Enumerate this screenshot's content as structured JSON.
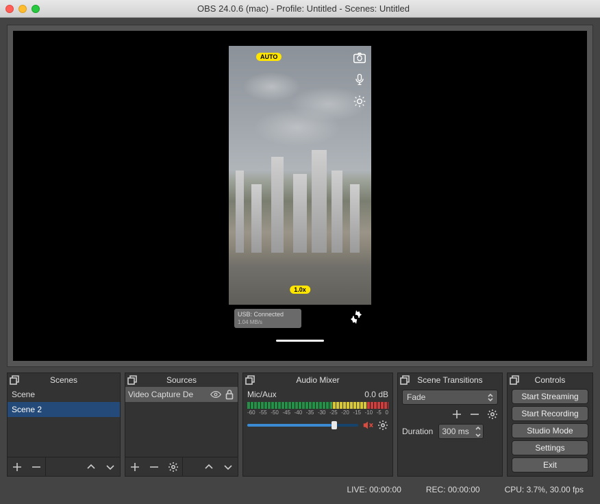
{
  "window": {
    "title": "OBS 24.0.6 (mac) - Profile: Untitled - Scenes: Untitled"
  },
  "preview": {
    "auto_badge": "AUTO",
    "zoom_badge": "1.0x",
    "usb_title": "USB: Connected",
    "usb_sub": "1.04 MB/s"
  },
  "docks": {
    "scenes": {
      "title": "Scenes",
      "items": [
        "Scene",
        "Scene 2"
      ],
      "selected": 1
    },
    "sources": {
      "title": "Sources",
      "items": [
        {
          "label": "Video Capture De"
        }
      ]
    },
    "mixer": {
      "title": "Audio Mixer",
      "channel": "Mic/Aux",
      "level": "0.0 dB",
      "ticks": [
        "-60",
        "-55",
        "-50",
        "-45",
        "-40",
        "-35",
        "-30",
        "-25",
        "-20",
        "-15",
        "-10",
        "-5",
        "0"
      ]
    },
    "transitions": {
      "title": "Scene Transitions",
      "selected": "Fade",
      "duration_label": "Duration",
      "duration_value": "300 ms"
    },
    "controls": {
      "title": "Controls",
      "buttons": [
        "Start Streaming",
        "Start Recording",
        "Studio Mode",
        "Settings",
        "Exit"
      ]
    }
  },
  "status": {
    "live": "LIVE: 00:00:00",
    "rec": "REC: 00:00:00",
    "cpu": "CPU: 3.7%, 30.00 fps"
  }
}
